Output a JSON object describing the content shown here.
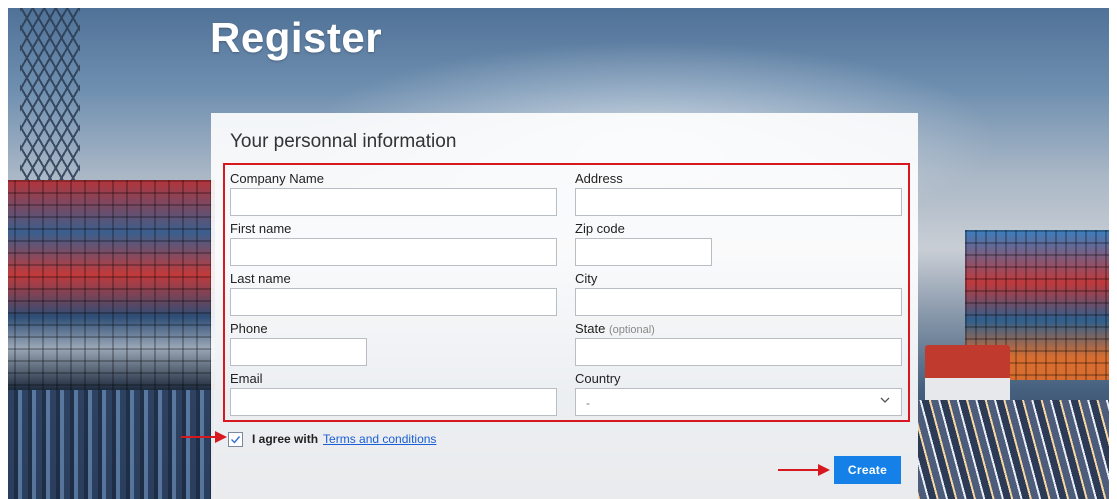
{
  "page": {
    "title": "Register"
  },
  "form": {
    "section_title": "Your personnal information",
    "fields": {
      "company_name": {
        "label": "Company Name",
        "value": ""
      },
      "first_name": {
        "label": "First name",
        "value": ""
      },
      "last_name": {
        "label": "Last name",
        "value": ""
      },
      "phone": {
        "label": "Phone",
        "value": ""
      },
      "email": {
        "label": "Email",
        "value": ""
      },
      "address": {
        "label": "Address",
        "value": ""
      },
      "zip_code": {
        "label": "Zip code",
        "value": ""
      },
      "city": {
        "label": "City",
        "value": ""
      },
      "state": {
        "label": "State",
        "optional_tag": "(optional)",
        "value": ""
      },
      "country": {
        "label": "Country",
        "selected": "-"
      }
    },
    "agree": {
      "checked": true,
      "text": "I agree with",
      "link_text": "Terms and conditions"
    },
    "submit_label": "Create"
  },
  "colors": {
    "highlight_border": "#d7191f",
    "annotation_arrow": "#d7191f",
    "button_bg": "#1480e8",
    "link": "#1a5fd6"
  },
  "icons": {
    "country_select": "chevron-down-icon",
    "agree_checkbox": "checkmark-icon",
    "annotation": "arrow-right-icon"
  }
}
